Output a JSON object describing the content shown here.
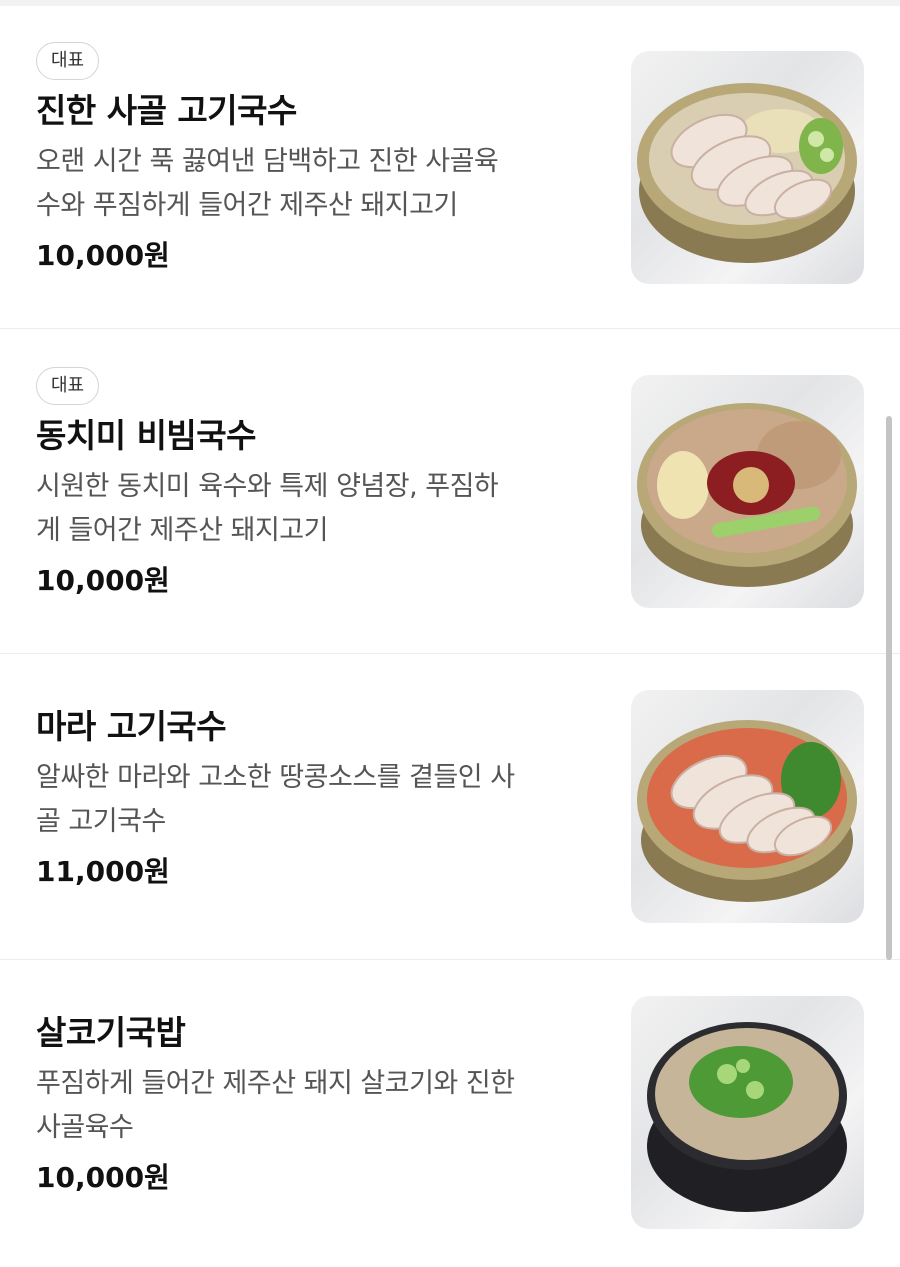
{
  "menu": {
    "items": [
      {
        "badge": "대표",
        "name": "진한 사골 고기국수",
        "desc_line1": "오랜 시간 푹 끓여낸 담백하고 진한 사골육",
        "desc_line2": "수와 푸짐하게 들어간 제주산 돼지고기",
        "price": "10,000원",
        "image_icon": "pork-noodle-soup-photo"
      },
      {
        "badge": "대표",
        "name": "동치미 비빔국수",
        "desc_line1": "시원한 동치미 육수와 특제 양념장, 푸짐하",
        "desc_line2": "게 들어간 제주산 돼지고기",
        "price": "10,000원",
        "image_icon": "spicy-bibim-noodle-photo"
      },
      {
        "badge": "",
        "name": "마라 고기국수",
        "desc_line1": "알싸한 마라와 고소한 땅콩소스를 곁들인 사",
        "desc_line2": "골 고기국수",
        "price": "11,000원",
        "image_icon": "mala-noodle-soup-photo"
      },
      {
        "badge": "",
        "name": "살코기국밥",
        "desc_line1": "푸짐하게 들어간 제주산 돼지 살코기와 진한",
        "desc_line2": "사골육수",
        "price": "10,000원",
        "image_icon": "shredded-pork-rice-soup-photo"
      }
    ]
  },
  "colors": {
    "text_primary": "#111111",
    "text_secondary": "#555555",
    "divider": "#ececec",
    "badge_border": "#d4d4d4"
  }
}
